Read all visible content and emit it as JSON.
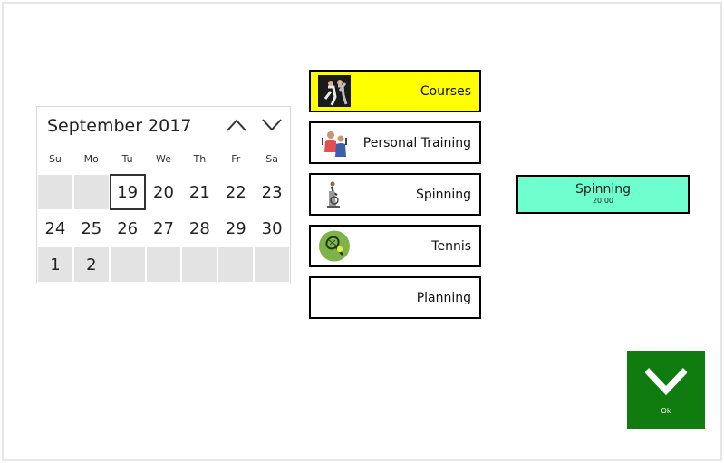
{
  "calendar": {
    "month_title": "September 2017",
    "days_of_week": [
      "Su",
      "Mo",
      "Tu",
      "We",
      "Th",
      "Fr",
      "Sa"
    ],
    "weeks": [
      [
        "",
        "",
        "19",
        "20",
        "21",
        "22",
        "23"
      ],
      [
        "24",
        "25",
        "26",
        "27",
        "28",
        "29",
        "30"
      ],
      [
        "1",
        "2",
        "",
        "",
        "",
        "",
        ""
      ]
    ],
    "today": "19",
    "prev_icon": "chevron-up-icon",
    "next_icon": "chevron-down-icon"
  },
  "menu": [
    {
      "label": "Courses",
      "icon": "courses-photo",
      "active": true
    },
    {
      "label": "Personal Training",
      "icon": "personal-training-photo",
      "active": false
    },
    {
      "label": "Spinning",
      "icon": "spinning-bike-photo",
      "active": false
    },
    {
      "label": "Tennis",
      "icon": "tennis-icon",
      "active": false
    },
    {
      "label": "Planning",
      "icon": "",
      "active": false
    }
  ],
  "slot": {
    "title": "Spinning",
    "time": "20:00"
  },
  "ok_button": {
    "label": "Ok",
    "icon": "chevron-down-icon"
  },
  "colors": {
    "active_menu": "#ffff00",
    "slot_background": "#6fffce",
    "ok_background": "#107c10",
    "calendar_filler": "#e3e3e3"
  }
}
